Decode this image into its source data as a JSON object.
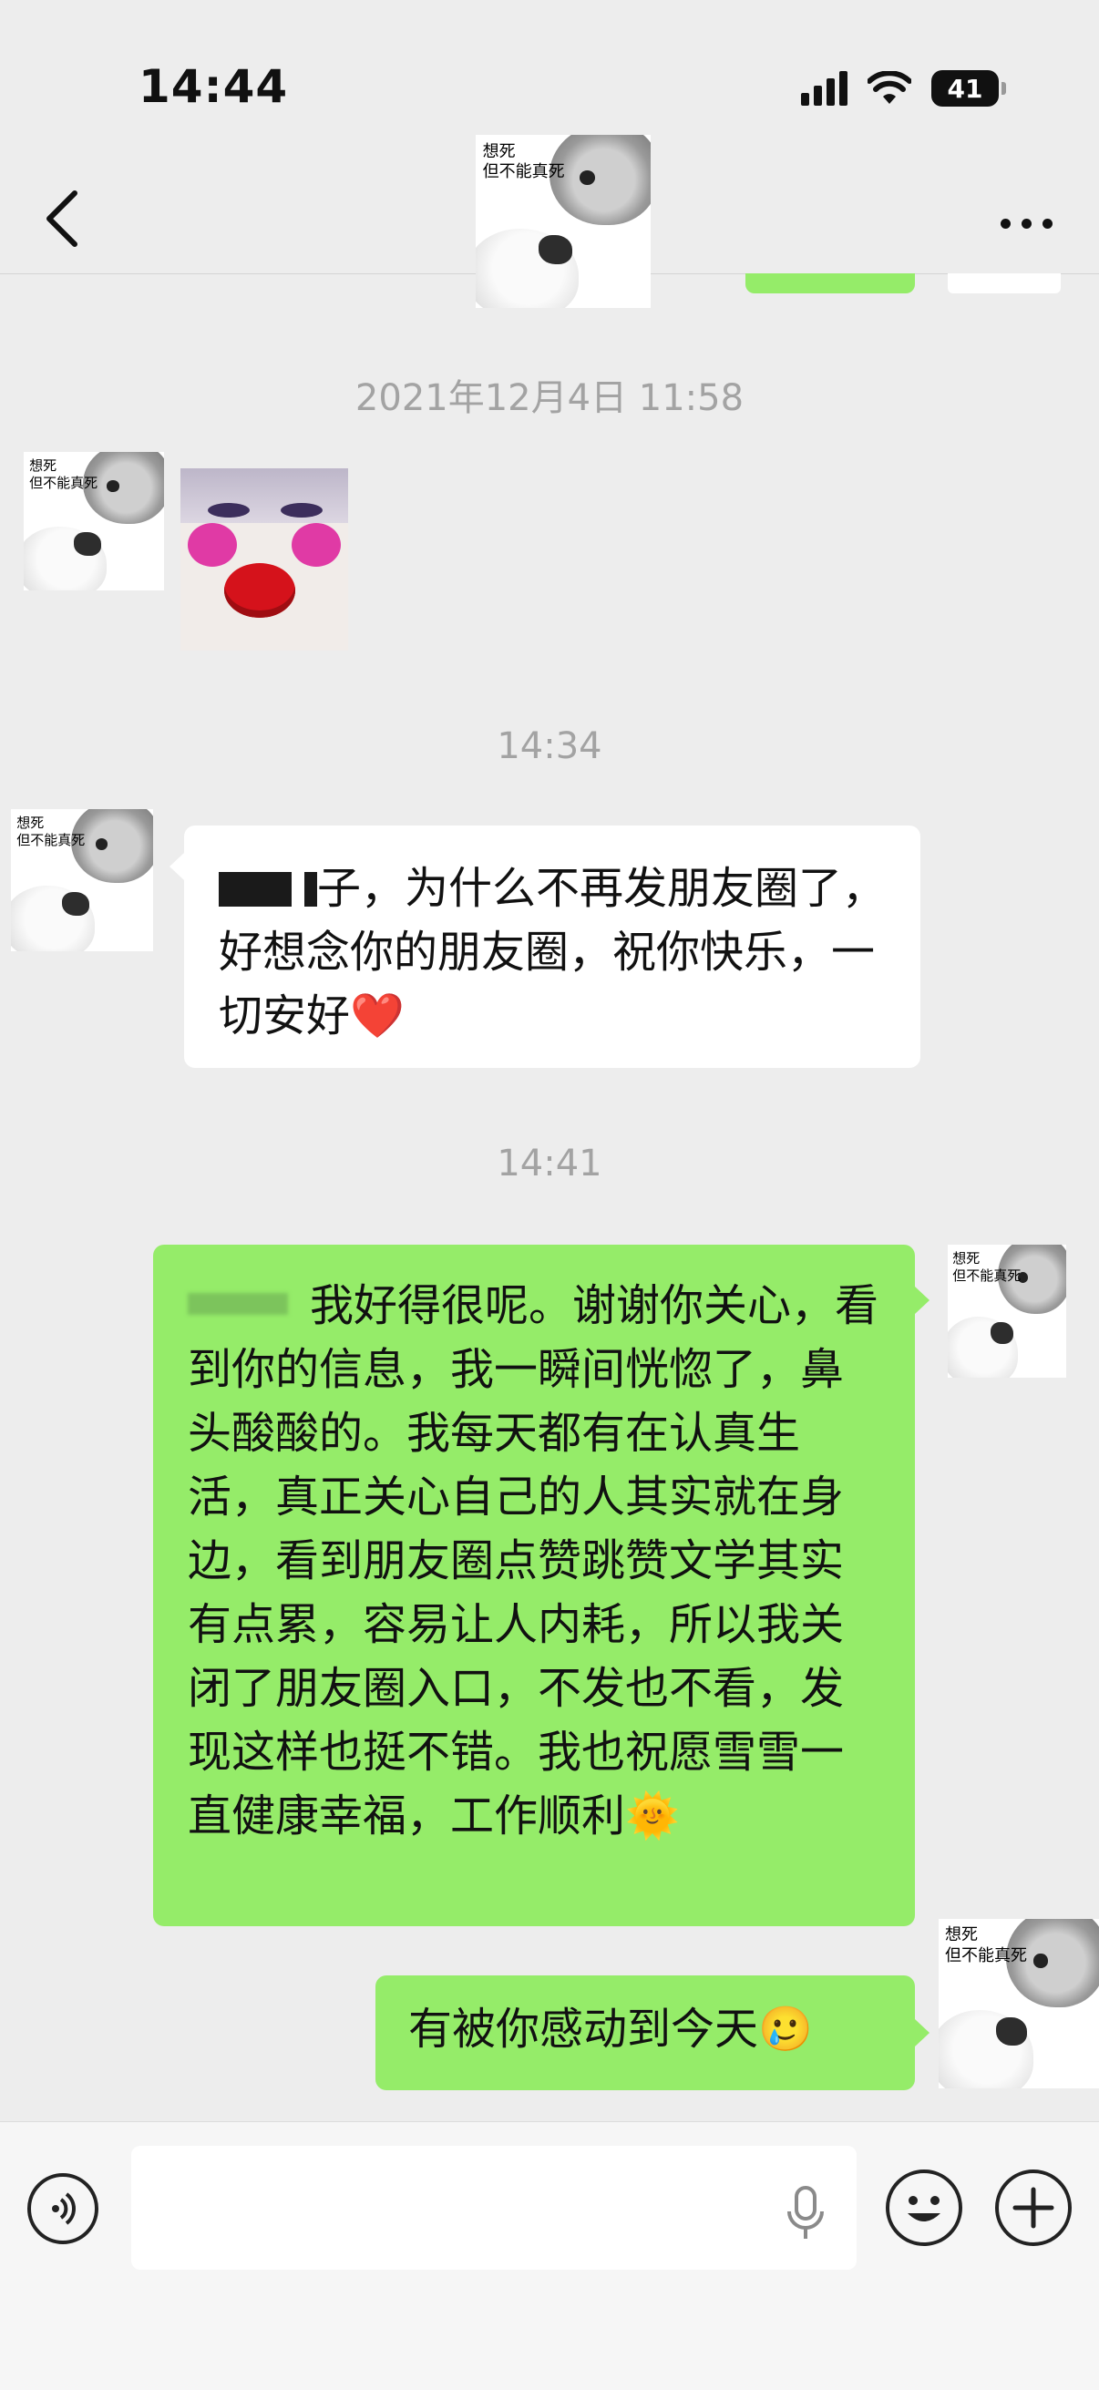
{
  "status_bar": {
    "time": "14:44",
    "battery": "41"
  },
  "header": {
    "avatar_caption": "想死\n但不能真死"
  },
  "timestamps": {
    "t1": "2021年12月4日 11:58",
    "t2": "14:34",
    "t3": "14:41"
  },
  "messages": {
    "m1_text": "子，为什么不再发朋友圈了，好想念你的朋友圈，祝你快乐，一切安好",
    "m1_emoji": "❤️",
    "m2_text": "我好得很呢。谢谢你关心，看到你的信息，我一瞬间恍惚了，鼻头酸酸的。我每天都有在认真生活，真正关心自己的人其实就在身边，看到朋友圈点赞跳赞文学其实有点累，容易让人内耗，所以我关闭了朋友圈入口，不发也不看，发现这样也挺不错。我也祝愿雪雪一直健康幸福，工作顺利",
    "m2_emoji": "🌞",
    "m3_text": "有被你感动到今天",
    "m3_emoji": "🥲"
  },
  "icons": [
    "back-arrow-icon",
    "more-icon",
    "voice-icon",
    "mic-icon",
    "emoji-icon",
    "plus-icon",
    "signal-icon",
    "wifi-icon",
    "battery-icon"
  ],
  "colors": {
    "background": "#ededed",
    "outgoing_bubble": "#95ec69",
    "incoming_bubble": "#ffffff",
    "timestamp": "#a3a3a3"
  }
}
